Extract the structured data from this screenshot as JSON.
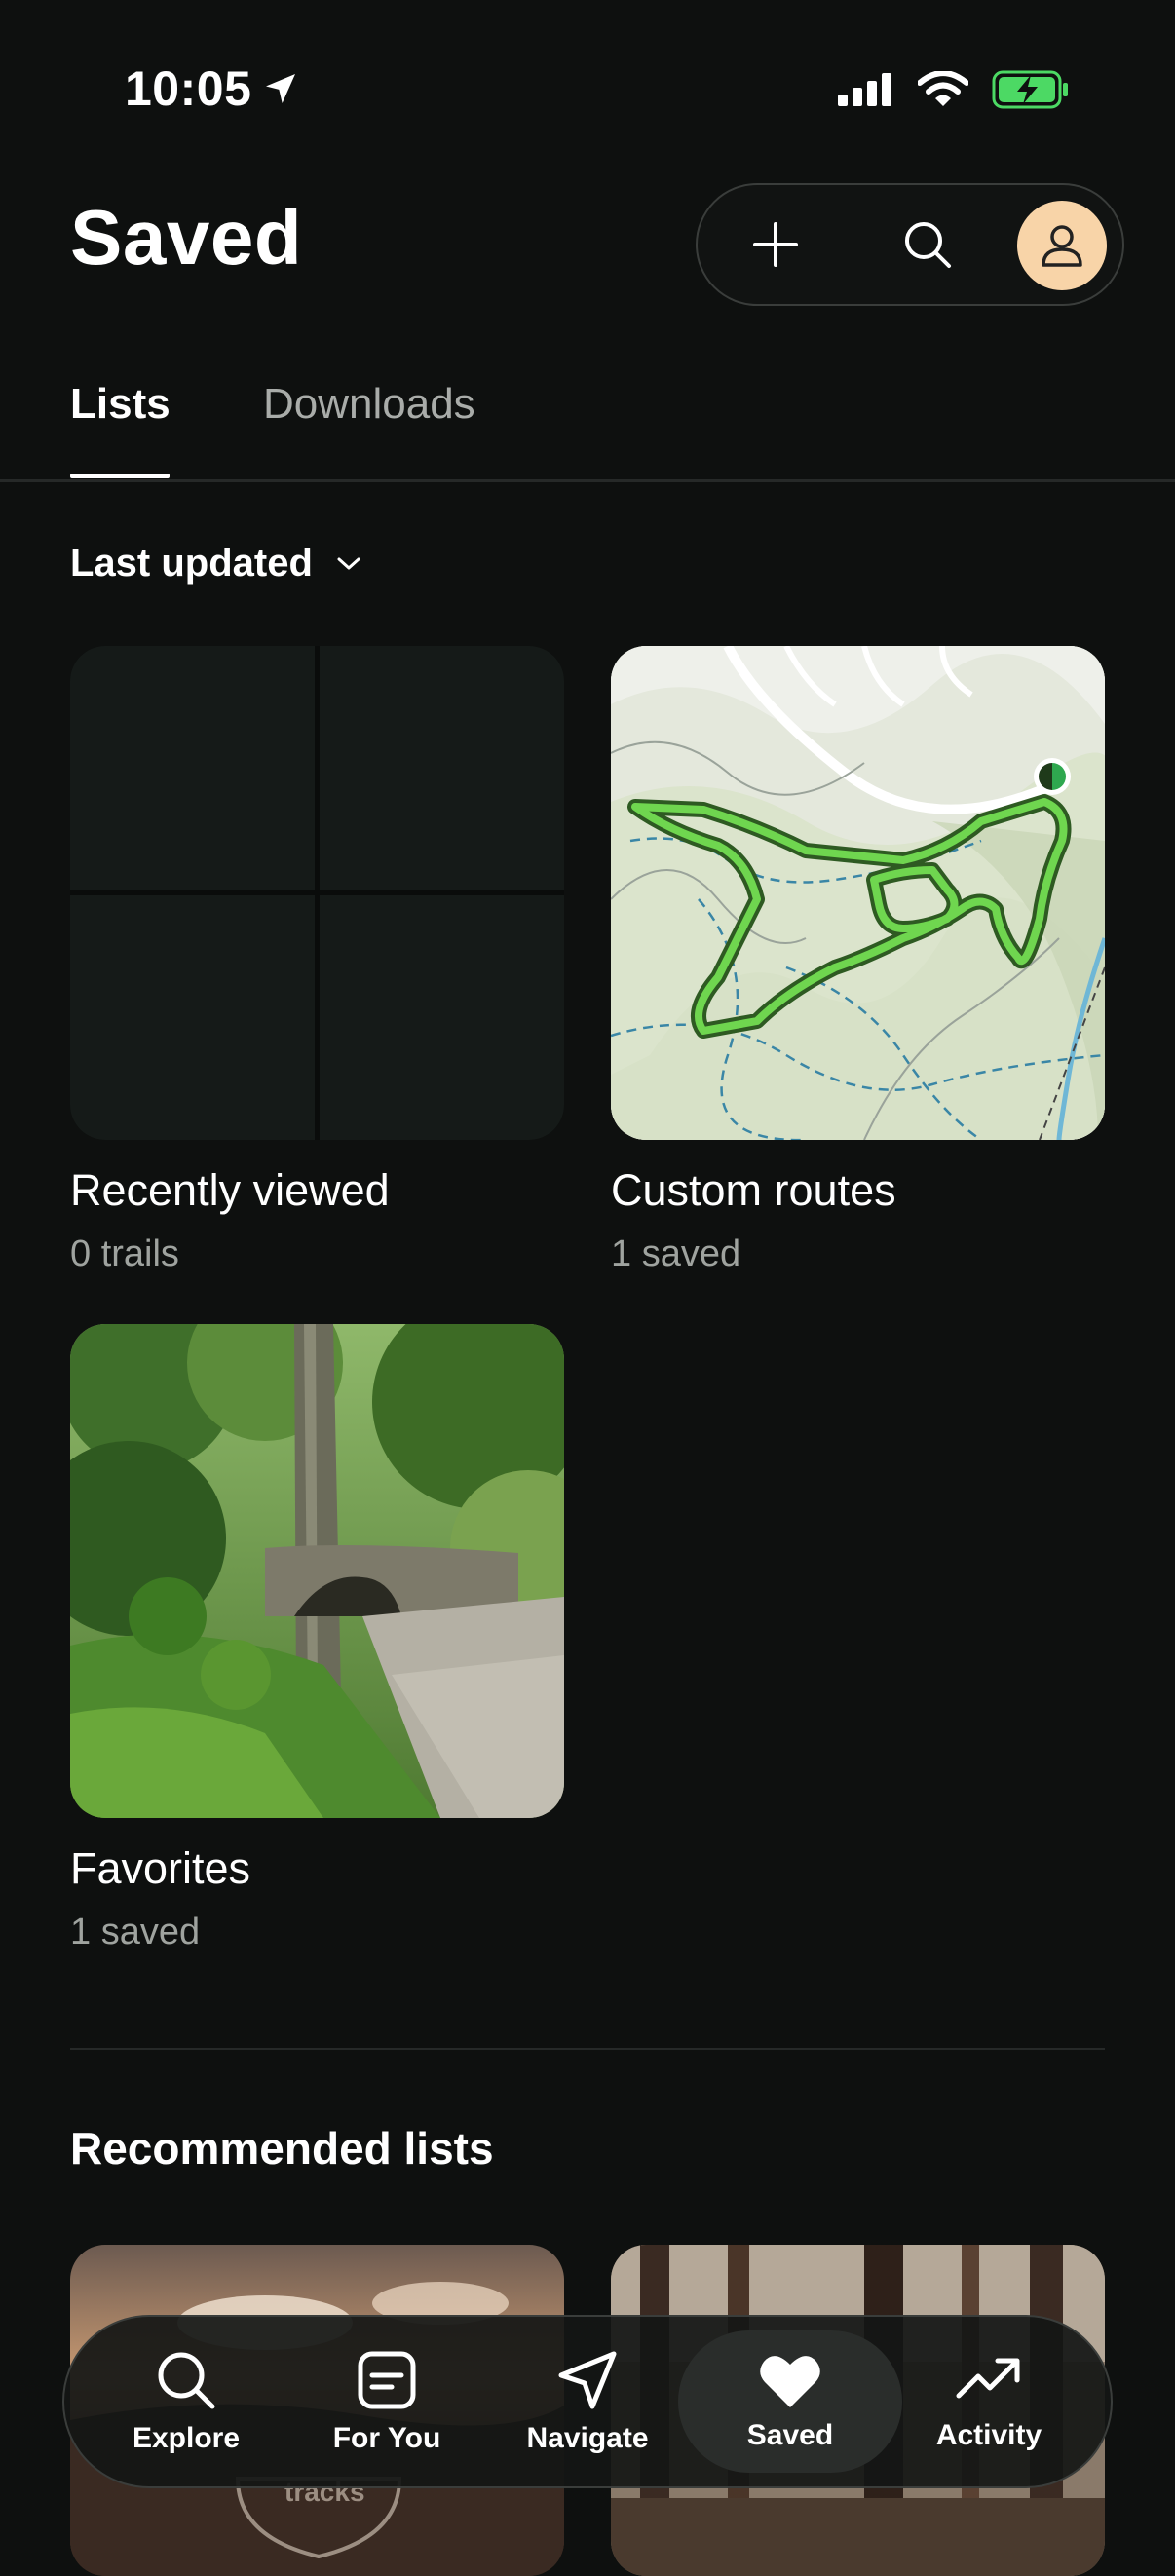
{
  "status": {
    "time": "10:05"
  },
  "header": {
    "title": "Saved"
  },
  "tabs": [
    {
      "label": "Lists"
    },
    {
      "label": "Downloads"
    }
  ],
  "sort": {
    "label": "Last updated"
  },
  "lists": [
    {
      "title": "Recently viewed",
      "subtitle": "0 trails"
    },
    {
      "title": "Custom routes",
      "subtitle": "1 saved"
    },
    {
      "title": "Favorites",
      "subtitle": "1 saved"
    }
  ],
  "recommended": {
    "title": "Recommended lists",
    "card_text": "tracks"
  },
  "nav": [
    {
      "label": "Explore",
      "icon": "search-icon"
    },
    {
      "label": "For You",
      "icon": "note-icon"
    },
    {
      "label": "Navigate",
      "icon": "navigate-arrow-icon"
    },
    {
      "label": "Saved",
      "icon": "heart-icon"
    },
    {
      "label": "Activity",
      "icon": "trend-up-icon"
    }
  ],
  "colors": {
    "background": "#0e100f",
    "accent_route": "#6fd64f",
    "avatar_bg": "#f8d4a8",
    "battery": "#4cd964"
  }
}
